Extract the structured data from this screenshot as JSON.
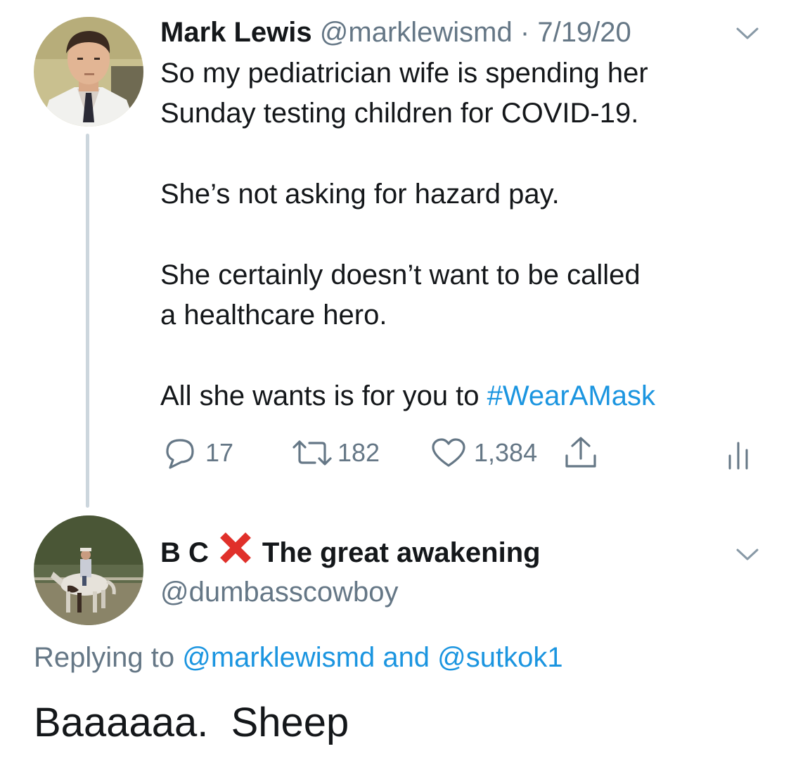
{
  "tweet1": {
    "author_name": "Mark Lewis",
    "handle": "@marklewismd",
    "separator": "·",
    "date": "7/19/20",
    "avatar_icon": "avatar-man-in-white-coat",
    "lines": [
      "So my pediatrician wife is spending her",
      "Sunday testing children for COVID-19.",
      "She’s not asking for hazard pay.",
      "She certainly doesn’t want to be called",
      "a healthcare hero.",
      "All she wants is for you to "
    ],
    "hashtag": "#WearAMask",
    "actions": {
      "reply_count": "17",
      "retweet_count": "182",
      "like_count": "1,384"
    }
  },
  "tweet2": {
    "name_prefix": "B C",
    "name_suffix": "The great awakening",
    "handle": "@dumbasscowboy",
    "avatar_icon": "avatar-horse-rider",
    "replying_prefix": "Replying to ",
    "mention1": "@marklewismd",
    "replying_and": " and ",
    "mention2": "@sutkok1",
    "text": "Baaaaaa.  Sheep"
  },
  "colors": {
    "text": "#14171a",
    "muted": "#657786",
    "link": "#1b95e0",
    "thread_line": "#ccd6dd",
    "cross": "#e0302a"
  }
}
